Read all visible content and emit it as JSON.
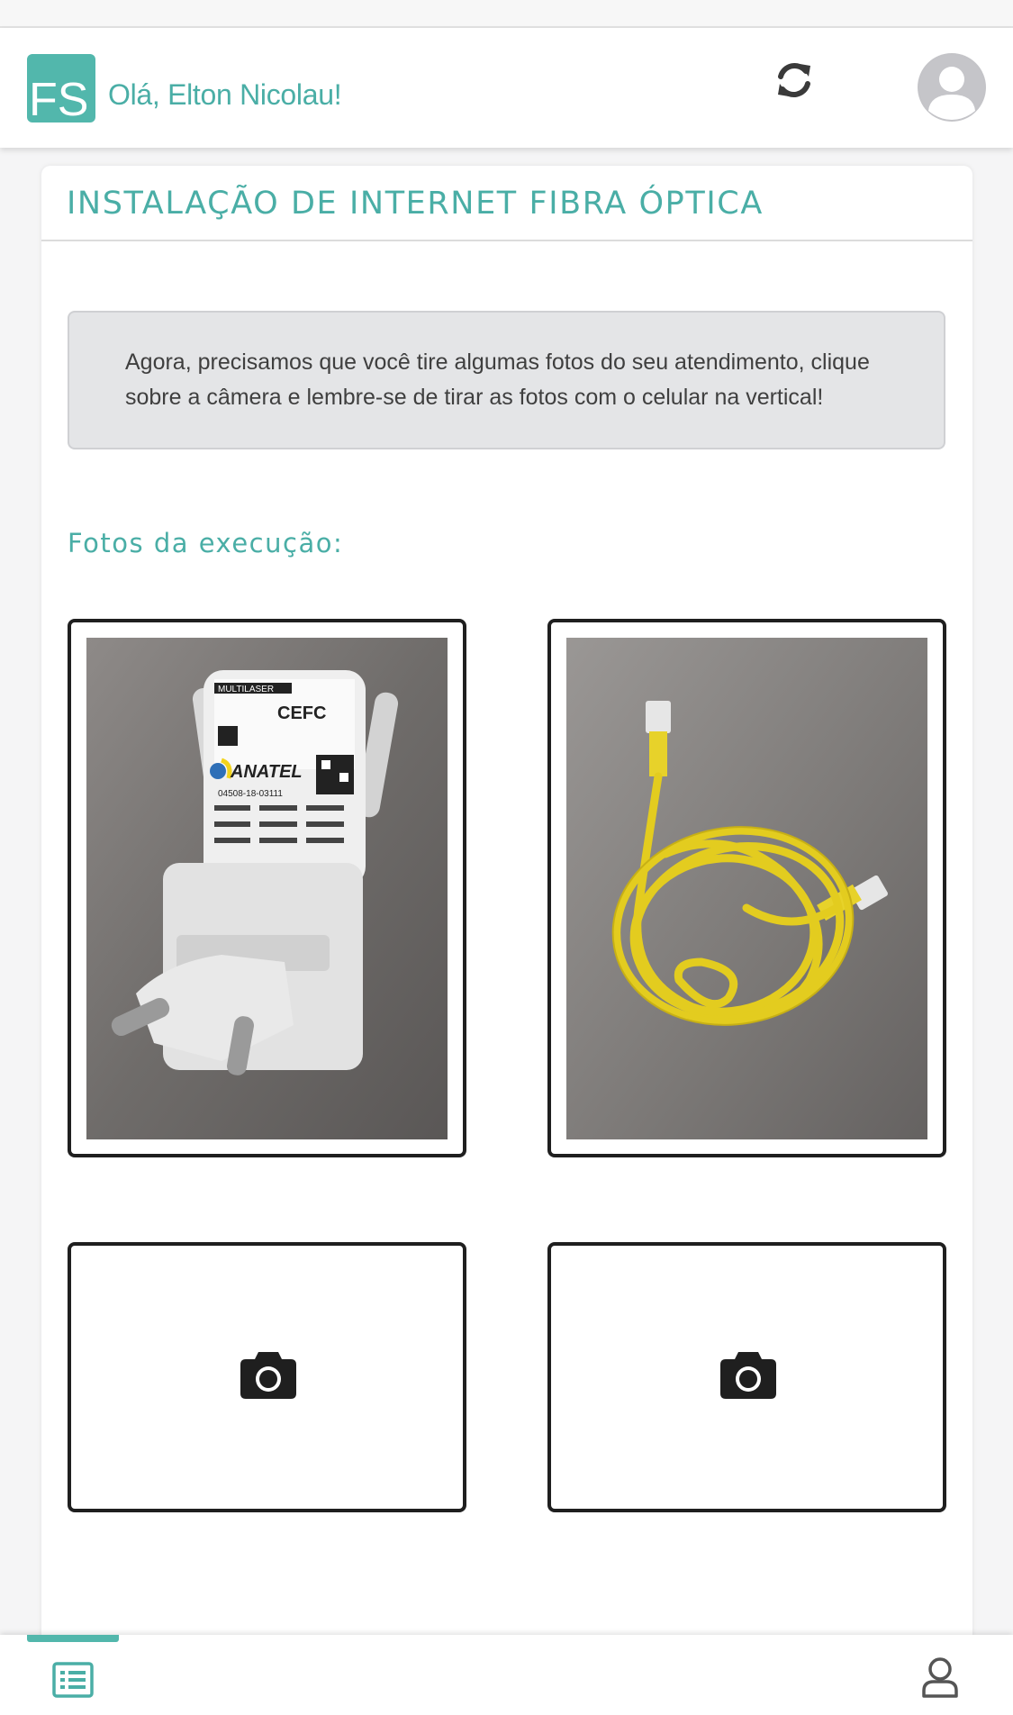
{
  "header": {
    "logo_text": "FS",
    "greeting": "Olá, Elton Nicolau!",
    "refresh_icon": "refresh-icon",
    "avatar_icon": "user-avatar-icon"
  },
  "card": {
    "title": "INSTALAÇÃO DE INTERNET FIBRA ÓPTICA",
    "notice": "Agora, precisamos que você tire algumas fotos do seu atendimento, clique sobre a câmera e lembre-se de tirar as fotos com o celular na vertical!",
    "photos_label": "Fotos da execução:",
    "photos": [
      {
        "state": "filled",
        "subject": "wifi-repeater"
      },
      {
        "state": "filled",
        "subject": "yellow-ethernet-cable"
      },
      {
        "state": "empty",
        "icon": "camera-icon"
      },
      {
        "state": "empty",
        "icon": "camera-icon"
      }
    ],
    "repeater_label": {
      "brand": "MULTILASER",
      "ce": "CEFC",
      "anatel": "ANATEL",
      "code": "04508-18-03111"
    }
  },
  "bottom_nav": {
    "items": [
      {
        "icon": "list-icon",
        "active": true
      },
      {
        "icon": "user-icon",
        "active": false
      }
    ]
  },
  "colors": {
    "accent": "#4aaea6",
    "notice_bg": "#e4e5e7"
  }
}
